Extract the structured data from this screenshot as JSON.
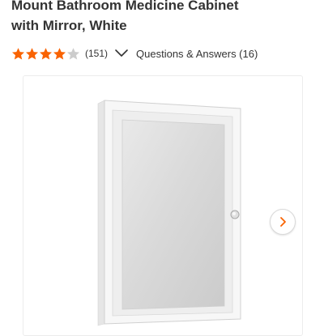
{
  "product": {
    "title_line1": "Mount Bathroom Medicine Cabinet",
    "title_line2": "with Mirror, White"
  },
  "rating": {
    "stars": 4,
    "max_stars": 5,
    "review_count": "(151)",
    "qa_label": "Questions & Answers (16)"
  },
  "colors": {
    "star_filled": "#f96302",
    "star_empty": "#cccccc",
    "accent": "#f96302"
  },
  "icons": {
    "chevron": "chevron-down-icon",
    "next": "chevron-right-icon"
  }
}
